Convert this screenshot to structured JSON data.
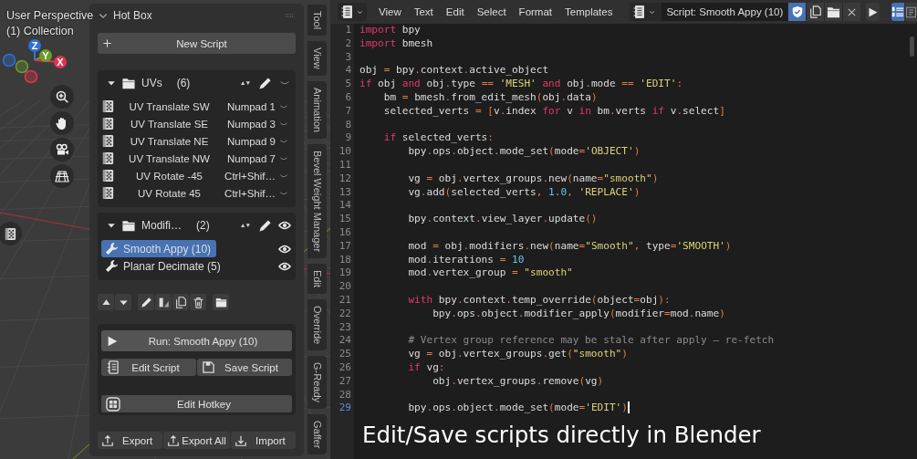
{
  "viewport": {
    "view_name": "User Perspective",
    "collection": "(1) Collection",
    "gizmo_axes": [
      {
        "label": "Z",
        "color": "#2f6fd6"
      },
      {
        "label": "Y",
        "color": "#6f9a2c"
      },
      {
        "label": "X",
        "color": "#e0344f"
      }
    ]
  },
  "hot_box": {
    "title": "Hot Box",
    "new_script": "New Script",
    "folders": [
      {
        "name": "UVs",
        "count": "(6)",
        "expanded": true,
        "kind": "hotkeys",
        "items": [
          {
            "name": "UV Translate SW",
            "hotkey": "Numpad 1",
            "selected": false
          },
          {
            "name": "UV Translate SE",
            "hotkey": "Numpad 3",
            "selected": false
          },
          {
            "name": "UV Translate NE",
            "hotkey": "Numpad 9",
            "selected": false
          },
          {
            "name": "UV Translate NW",
            "hotkey": "Numpad 7",
            "selected": false
          },
          {
            "name": "UV Rotate -45",
            "hotkey": "Ctrl+Shif…",
            "selected": false
          },
          {
            "name": "UV Rotate 45",
            "hotkey": "Ctrl+Shif…",
            "selected": false
          }
        ]
      },
      {
        "name": "Modifi…",
        "count": "(2)",
        "expanded": true,
        "kind": "modifiers",
        "items": [
          {
            "name": "Smooth Appy (10)",
            "selected": true,
            "visible": true
          },
          {
            "name": "Planar Decimate (5)",
            "selected": false,
            "visible": true
          }
        ]
      }
    ],
    "run_button": "Run: Smooth Appy (10)",
    "edit_script": "Edit Script",
    "save_script": "Save Script",
    "edit_hotkey": "Edit Hotkey",
    "footer_buttons": [
      {
        "label": "Export",
        "kind": "export"
      },
      {
        "label": "Export All",
        "kind": "export"
      },
      {
        "label": "Import",
        "kind": "import"
      }
    ]
  },
  "sidebar_tabs": [
    "Tool",
    "View",
    "Animation",
    "Bevel Weight Manager",
    "Edit",
    "Override",
    "G-Ready",
    "Gaffer"
  ],
  "editor": {
    "menus": [
      "View",
      "Text",
      "Edit",
      "Select",
      "Format",
      "Templates"
    ],
    "text_name": "Script: Smooth Appy (10)",
    "trusted": true,
    "line_numbers": true,
    "word_wrap": false,
    "lines": [
      {
        "number": "1",
        "current": false,
        "tokens": [
          {
            "kind": "keyword",
            "text": "import"
          },
          {
            "kind": "plain",
            "text": " bpy"
          }
        ]
      },
      {
        "number": "2",
        "current": false,
        "tokens": [
          {
            "kind": "keyword",
            "text": "import"
          },
          {
            "kind": "plain",
            "text": " bmesh"
          }
        ]
      },
      {
        "number": "3",
        "current": false
      },
      {
        "number": "4",
        "current": false,
        "tokens": [
          {
            "kind": "plain",
            "text": "obj "
          },
          {
            "kind": "operator",
            "text": "="
          },
          {
            "kind": "plain",
            "text": " bpy"
          },
          {
            "kind": "operator",
            "text": "."
          },
          {
            "kind": "plain",
            "text": "context"
          },
          {
            "kind": "operator",
            "text": "."
          },
          {
            "kind": "plain",
            "text": "active_object"
          }
        ]
      },
      {
        "number": "5",
        "current": false,
        "tokens": [
          {
            "kind": "keyword",
            "text": "if"
          },
          {
            "kind": "plain",
            "text": " obj "
          },
          {
            "kind": "keyword",
            "text": "and"
          },
          {
            "kind": "plain",
            "text": " obj"
          },
          {
            "kind": "operator",
            "text": "."
          },
          {
            "kind": "plain",
            "text": "type "
          },
          {
            "kind": "operator",
            "text": "== "
          },
          {
            "kind": "string",
            "text": "'MESH'"
          },
          {
            "kind": "keyword",
            "text": " and"
          },
          {
            "kind": "plain",
            "text": " obj"
          },
          {
            "kind": "operator",
            "text": "."
          },
          {
            "kind": "plain",
            "text": "mode "
          },
          {
            "kind": "operator",
            "text": "== "
          },
          {
            "kind": "string",
            "text": "'EDIT'"
          },
          {
            "kind": "operator",
            "text": ":"
          }
        ]
      },
      {
        "number": "6",
        "current": false,
        "tokens": [
          {
            "kind": "plain",
            "text": "    bm "
          },
          {
            "kind": "operator",
            "text": "="
          },
          {
            "kind": "plain",
            "text": " bmesh"
          },
          {
            "kind": "operator",
            "text": "."
          },
          {
            "kind": "plain",
            "text": "from_edit_mesh"
          },
          {
            "kind": "operator",
            "text": "("
          },
          {
            "kind": "plain",
            "text": "obj"
          },
          {
            "kind": "operator",
            "text": "."
          },
          {
            "kind": "plain",
            "text": "data"
          },
          {
            "kind": "operator",
            "text": ")"
          }
        ]
      },
      {
        "number": "7",
        "current": false,
        "tokens": [
          {
            "kind": "plain",
            "text": "    selected_verts "
          },
          {
            "kind": "operator",
            "text": "= ["
          },
          {
            "kind": "plain",
            "text": "v"
          },
          {
            "kind": "operator",
            "text": "."
          },
          {
            "kind": "plain",
            "text": "index "
          },
          {
            "kind": "keyword",
            "text": "for"
          },
          {
            "kind": "plain",
            "text": " v "
          },
          {
            "kind": "keyword",
            "text": "in"
          },
          {
            "kind": "plain",
            "text": " bm"
          },
          {
            "kind": "operator",
            "text": "."
          },
          {
            "kind": "plain",
            "text": "verts "
          },
          {
            "kind": "keyword",
            "text": "if"
          },
          {
            "kind": "plain",
            "text": " v"
          },
          {
            "kind": "operator",
            "text": "."
          },
          {
            "kind": "plain",
            "text": "select"
          },
          {
            "kind": "operator",
            "text": "]"
          }
        ]
      },
      {
        "number": "8",
        "current": false
      },
      {
        "number": "9",
        "current": false,
        "tokens": [
          {
            "kind": "keyword",
            "text": "    if"
          },
          {
            "kind": "plain",
            "text": " selected_verts"
          },
          {
            "kind": "operator",
            "text": ":"
          }
        ]
      },
      {
        "number": "10",
        "current": false,
        "tokens": [
          {
            "kind": "plain",
            "text": "        bpy"
          },
          {
            "kind": "operator",
            "text": "."
          },
          {
            "kind": "plain",
            "text": "ops"
          },
          {
            "kind": "operator",
            "text": "."
          },
          {
            "kind": "plain",
            "text": "object"
          },
          {
            "kind": "operator",
            "text": "."
          },
          {
            "kind": "plain",
            "text": "mode_set"
          },
          {
            "kind": "operator",
            "text": "("
          },
          {
            "kind": "plain",
            "text": "mode"
          },
          {
            "kind": "operator",
            "text": "="
          },
          {
            "kind": "string",
            "text": "'OBJECT'"
          },
          {
            "kind": "operator",
            "text": ")"
          }
        ]
      },
      {
        "number": "11",
        "current": false
      },
      {
        "number": "12",
        "current": false,
        "tokens": [
          {
            "kind": "plain",
            "text": "        vg "
          },
          {
            "kind": "operator",
            "text": "="
          },
          {
            "kind": "plain",
            "text": " obj"
          },
          {
            "kind": "operator",
            "text": "."
          },
          {
            "kind": "plain",
            "text": "vertex_groups"
          },
          {
            "kind": "operator",
            "text": "."
          },
          {
            "kind": "plain",
            "text": "new"
          },
          {
            "kind": "operator",
            "text": "("
          },
          {
            "kind": "plain",
            "text": "name"
          },
          {
            "kind": "operator",
            "text": "="
          },
          {
            "kind": "string",
            "text": "\"smooth\""
          },
          {
            "kind": "operator",
            "text": ")"
          }
        ]
      },
      {
        "number": "13",
        "current": false,
        "tokens": [
          {
            "kind": "plain",
            "text": "        vg"
          },
          {
            "kind": "operator",
            "text": "."
          },
          {
            "kind": "plain",
            "text": "add"
          },
          {
            "kind": "operator",
            "text": "("
          },
          {
            "kind": "plain",
            "text": "selected_verts"
          },
          {
            "kind": "operator",
            "text": ", "
          },
          {
            "kind": "number",
            "text": "1.0"
          },
          {
            "kind": "operator",
            "text": ", "
          },
          {
            "kind": "string",
            "text": "'REPLACE'"
          },
          {
            "kind": "operator",
            "text": ")"
          }
        ]
      },
      {
        "number": "14",
        "current": false
      },
      {
        "number": "15",
        "current": false,
        "tokens": [
          {
            "kind": "plain",
            "text": "        bpy"
          },
          {
            "kind": "operator",
            "text": "."
          },
          {
            "kind": "plain",
            "text": "context"
          },
          {
            "kind": "operator",
            "text": "."
          },
          {
            "kind": "plain",
            "text": "view_layer"
          },
          {
            "kind": "operator",
            "text": "."
          },
          {
            "kind": "plain",
            "text": "update"
          },
          {
            "kind": "operator",
            "text": "()"
          }
        ]
      },
      {
        "number": "16",
        "current": false
      },
      {
        "number": "17",
        "current": false,
        "tokens": [
          {
            "kind": "plain",
            "text": "        mod "
          },
          {
            "kind": "operator",
            "text": "="
          },
          {
            "kind": "plain",
            "text": " obj"
          },
          {
            "kind": "operator",
            "text": "."
          },
          {
            "kind": "plain",
            "text": "modifiers"
          },
          {
            "kind": "operator",
            "text": "."
          },
          {
            "kind": "plain",
            "text": "new"
          },
          {
            "kind": "operator",
            "text": "("
          },
          {
            "kind": "plain",
            "text": "name"
          },
          {
            "kind": "operator",
            "text": "="
          },
          {
            "kind": "string",
            "text": "\"Smooth\""
          },
          {
            "kind": "operator",
            "text": ","
          },
          {
            "kind": "plain",
            "text": " type"
          },
          {
            "kind": "operator",
            "text": "="
          },
          {
            "kind": "string",
            "text": "'SMOOTH'"
          },
          {
            "kind": "operator",
            "text": ")"
          }
        ]
      },
      {
        "number": "18",
        "current": false,
        "tokens": [
          {
            "kind": "plain",
            "text": "        mod"
          },
          {
            "kind": "operator",
            "text": "."
          },
          {
            "kind": "plain",
            "text": "iterations "
          },
          {
            "kind": "operator",
            "text": "= "
          },
          {
            "kind": "number",
            "text": "10"
          }
        ]
      },
      {
        "number": "19",
        "current": false,
        "tokens": [
          {
            "kind": "plain",
            "text": "        mod"
          },
          {
            "kind": "operator",
            "text": "."
          },
          {
            "kind": "plain",
            "text": "vertex_group "
          },
          {
            "kind": "operator",
            "text": "= "
          },
          {
            "kind": "string",
            "text": "\"smooth\""
          }
        ]
      },
      {
        "number": "20",
        "current": false
      },
      {
        "number": "21",
        "current": false,
        "tokens": [
          {
            "kind": "keyword",
            "text": "        with"
          },
          {
            "kind": "plain",
            "text": " bpy"
          },
          {
            "kind": "operator",
            "text": "."
          },
          {
            "kind": "plain",
            "text": "context"
          },
          {
            "kind": "operator",
            "text": "."
          },
          {
            "kind": "plain",
            "text": "temp_override"
          },
          {
            "kind": "operator",
            "text": "("
          },
          {
            "kind": "plain",
            "text": "object"
          },
          {
            "kind": "operator",
            "text": "="
          },
          {
            "kind": "plain",
            "text": "obj"
          },
          {
            "kind": "operator",
            "text": "):"
          }
        ]
      },
      {
        "number": "22",
        "current": false,
        "tokens": [
          {
            "kind": "plain",
            "text": "            bpy"
          },
          {
            "kind": "operator",
            "text": "."
          },
          {
            "kind": "plain",
            "text": "ops"
          },
          {
            "kind": "operator",
            "text": "."
          },
          {
            "kind": "plain",
            "text": "object"
          },
          {
            "kind": "operator",
            "text": "."
          },
          {
            "kind": "plain",
            "text": "modifier_apply"
          },
          {
            "kind": "operator",
            "text": "("
          },
          {
            "kind": "plain",
            "text": "modifier"
          },
          {
            "kind": "operator",
            "text": "="
          },
          {
            "kind": "plain",
            "text": "mod"
          },
          {
            "kind": "operator",
            "text": "."
          },
          {
            "kind": "plain",
            "text": "name"
          },
          {
            "kind": "operator",
            "text": ")"
          }
        ]
      },
      {
        "number": "23",
        "current": false
      },
      {
        "number": "24",
        "current": false,
        "tokens": [
          {
            "kind": "comment",
            "text": "        # Vertex group reference may be stale after apply — re-fetch"
          }
        ]
      },
      {
        "number": "25",
        "current": false,
        "tokens": [
          {
            "kind": "plain",
            "text": "        vg "
          },
          {
            "kind": "operator",
            "text": "="
          },
          {
            "kind": "plain",
            "text": " obj"
          },
          {
            "kind": "operator",
            "text": "."
          },
          {
            "kind": "plain",
            "text": "vertex_groups"
          },
          {
            "kind": "operator",
            "text": "."
          },
          {
            "kind": "plain",
            "text": "get"
          },
          {
            "kind": "operator",
            "text": "("
          },
          {
            "kind": "string",
            "text": "\"smooth\""
          },
          {
            "kind": "operator",
            "text": ")"
          }
        ]
      },
      {
        "number": "26",
        "current": false,
        "tokens": [
          {
            "kind": "keyword",
            "text": "        if"
          },
          {
            "kind": "plain",
            "text": " vg"
          },
          {
            "kind": "operator",
            "text": ":"
          }
        ]
      },
      {
        "number": "27",
        "current": false,
        "tokens": [
          {
            "kind": "plain",
            "text": "            obj"
          },
          {
            "kind": "operator",
            "text": "."
          },
          {
            "kind": "plain",
            "text": "vertex_groups"
          },
          {
            "kind": "operator",
            "text": "."
          },
          {
            "kind": "plain",
            "text": "remove"
          },
          {
            "kind": "operator",
            "text": "("
          },
          {
            "kind": "plain",
            "text": "vg"
          },
          {
            "kind": "operator",
            "text": ")"
          }
        ]
      },
      {
        "number": "28",
        "current": false
      },
      {
        "number": "29",
        "current": true,
        "tokens": [
          {
            "kind": "plain",
            "text": "        bpy"
          },
          {
            "kind": "operator",
            "text": "."
          },
          {
            "kind": "plain",
            "text": "ops"
          },
          {
            "kind": "operator",
            "text": "."
          },
          {
            "kind": "plain",
            "text": "object"
          },
          {
            "kind": "operator",
            "text": "."
          },
          {
            "kind": "plain",
            "text": "mode_set"
          },
          {
            "kind": "operator",
            "text": "("
          },
          {
            "kind": "plain",
            "text": "mode"
          },
          {
            "kind": "operator",
            "text": "="
          },
          {
            "kind": "string",
            "text": "'EDIT'"
          },
          {
            "kind": "operator",
            "text": ")"
          }
        ]
      }
    ],
    "caption": "Edit/Save scripts directly in Blender"
  }
}
